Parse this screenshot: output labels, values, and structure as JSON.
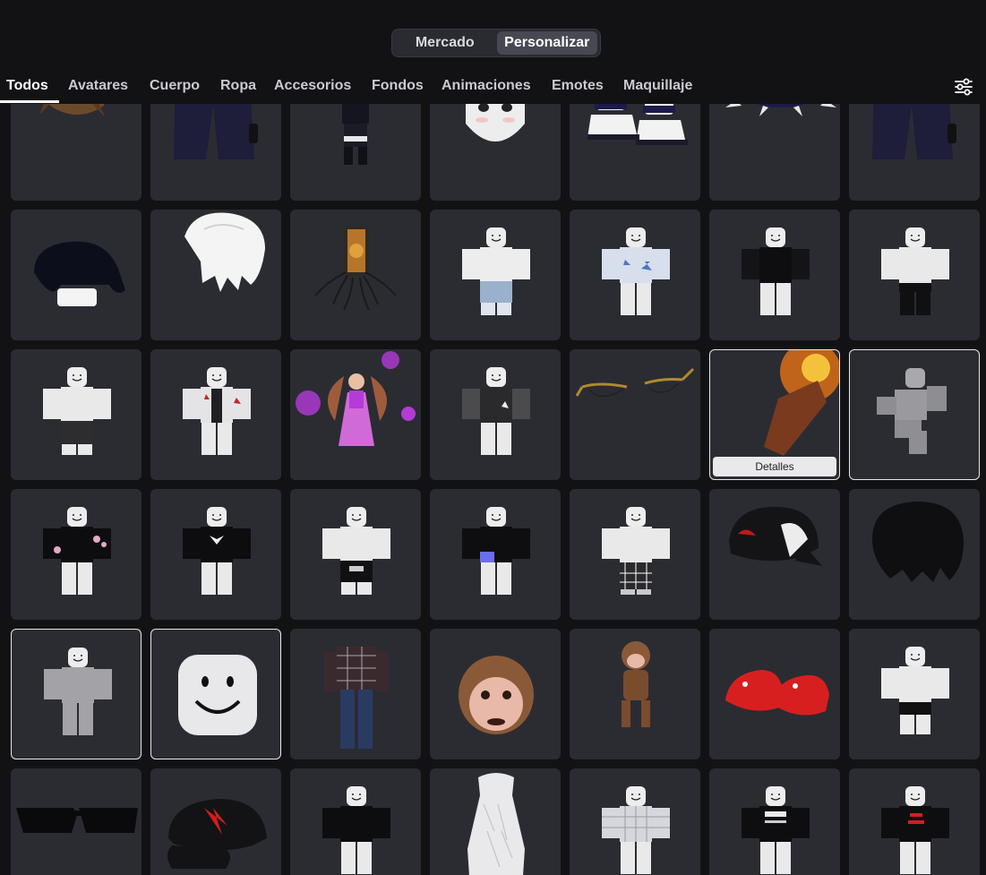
{
  "mode_switch": {
    "market_label": "Mercado",
    "customize_label": "Personalizar",
    "active": "Personalizar"
  },
  "tabs": [
    {
      "label": "Todos",
      "active": true
    },
    {
      "label": "Avatares"
    },
    {
      "label": "Cuerpo"
    },
    {
      "label": "Ropa"
    },
    {
      "label": "Accesorios"
    },
    {
      "label": "Fondos"
    },
    {
      "label": "Animaciones"
    },
    {
      "label": "Emotes"
    },
    {
      "label": "Maquillaje"
    }
  ],
  "filter_icon": "sliders-icon",
  "colors": {
    "background": "#121215",
    "tile": "#2b2c32",
    "selected_border": "#e8e8ec",
    "accent_white": "#ffffff"
  },
  "grid": {
    "details_label": "Detalles",
    "items": [
      {
        "kind": "brown-hair"
      },
      {
        "kind": "dark-pants"
      },
      {
        "kind": "anime-avatar"
      },
      {
        "kind": "white-head-face"
      },
      {
        "kind": "white-boots"
      },
      {
        "kind": "spiked-collar"
      },
      {
        "kind": "dark-pants"
      },
      {
        "kind": "black-hair"
      },
      {
        "kind": "white-hair"
      },
      {
        "kind": "spider-lantern"
      },
      {
        "kind": "avatar-jeans-top"
      },
      {
        "kind": "avatar-star-shirt"
      },
      {
        "kind": "avatar-black-shirt"
      },
      {
        "kind": "avatar-black-pants"
      },
      {
        "kind": "avatar-plain-skirt"
      },
      {
        "kind": "avatar-star-jacket"
      },
      {
        "kind": "fairy-avatar"
      },
      {
        "kind": "avatar-grey-star"
      },
      {
        "kind": "gold-glasses"
      },
      {
        "kind": "rocket-fire",
        "selected": true,
        "details": true
      },
      {
        "kind": "grey-running-avatar",
        "selected": true
      },
      {
        "kind": "avatar-blossom-shirt"
      },
      {
        "kind": "avatar-fox-shirt"
      },
      {
        "kind": "avatar-black-shorts"
      },
      {
        "kind": "avatar-character-shirt"
      },
      {
        "kind": "avatar-plaid-pants"
      },
      {
        "kind": "black-cap-red"
      },
      {
        "kind": "black-curly-hair"
      },
      {
        "kind": "grey-plain-avatar",
        "selected": true
      },
      {
        "kind": "smile-face",
        "selected": true
      },
      {
        "kind": "flannel-outfit"
      },
      {
        "kind": "monkey-head"
      },
      {
        "kind": "monkey-avatar"
      },
      {
        "kind": "red-clogs"
      },
      {
        "kind": "avatar-black-white-pants"
      },
      {
        "kind": "black-sunglasses"
      },
      {
        "kind": "black-cap-red-logo"
      },
      {
        "kind": "avatar-black-shirt-2"
      },
      {
        "kind": "white-shirt-tall"
      },
      {
        "kind": "avatar-plaid-shirt"
      },
      {
        "kind": "avatar-guapo-shirt"
      },
      {
        "kind": "avatar-red-text-shirt"
      }
    ]
  }
}
